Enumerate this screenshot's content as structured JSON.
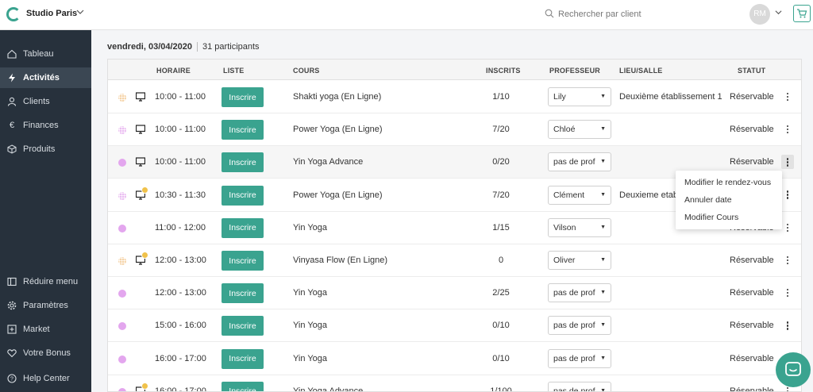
{
  "topbar": {
    "studio_name": "Studio Paris",
    "search_placeholder": "Rechercher par client",
    "avatar_initials": "RM"
  },
  "sidebar": {
    "items": [
      {
        "label": "Tableau",
        "icon": "home-icon"
      },
      {
        "label": "Activités",
        "icon": "lightning-icon",
        "active": true
      },
      {
        "label": "Clients",
        "icon": "user-icon"
      },
      {
        "label": "Finances",
        "icon": "euro-icon"
      },
      {
        "label": "Produits",
        "icon": "box-icon"
      }
    ],
    "bottom_items": [
      {
        "label": "Réduire menu",
        "icon": "sidebar-collapse-icon"
      },
      {
        "label": "Paramètres",
        "icon": "gear-icon"
      },
      {
        "label": "Market",
        "icon": "plus-square-icon"
      },
      {
        "label": "Votre Bonus",
        "icon": "heart-icon"
      },
      {
        "label": "Help Center",
        "icon": "help-icon"
      }
    ]
  },
  "main": {
    "date": "vendredi, 03/04/2020",
    "participants": "31 participants"
  },
  "table": {
    "headers": {
      "horaire": "HORAIRE",
      "liste": "LISTE",
      "cours": "COURS",
      "inscrits": "INSCRITS",
      "professeur": "PROFESSEUR",
      "lieu": "LIEU/SALLE",
      "statut": "STATUT"
    },
    "button_label": "Inscrire",
    "rows": [
      {
        "time": "10:00 - 11:00",
        "course": "Shakti yoga (En Ligne)",
        "inscrits": "1/10",
        "prof": "Lily",
        "lieu": "Deuxième établissement 1",
        "statut": "Réservable",
        "dot_color": "#f2c48a",
        "pattern": true,
        "online": true,
        "badge": false
      },
      {
        "time": "10:00 - 11:00",
        "course": "Power Yoga (En Ligne)",
        "inscrits": "7/20",
        "prof": "Chloé",
        "lieu": "",
        "statut": "Réservable",
        "dot_color": "#e3a6ee",
        "pattern": true,
        "online": true,
        "badge": false
      },
      {
        "time": "10:00 - 11:00",
        "course": "Yin Yoga Advance",
        "inscrits": "0/20",
        "prof": "pas de prof",
        "lieu": "",
        "statut": "Réservable",
        "dot_color": "#e3a6ee",
        "pattern": false,
        "online": true,
        "badge": false
      },
      {
        "time": "10:30 - 11:30",
        "course": "Power Yoga (En Ligne)",
        "inscrits": "7/20",
        "prof": "Clément",
        "lieu": "Deuxieme etab",
        "statut": "",
        "dot_color": "#e3a6ee",
        "pattern": true,
        "online": true,
        "badge": true
      },
      {
        "time": "11:00 - 12:00",
        "course": "Yin Yoga",
        "inscrits": "1/15",
        "prof": "Vilson",
        "lieu": "",
        "statut": "Réservable",
        "dot_color": "#e3a6ee",
        "pattern": false,
        "online": false,
        "badge": false
      },
      {
        "time": "12:00 - 13:00",
        "course": "Vinyasa Flow (En Ligne)",
        "inscrits": "0",
        "prof": "Oliver",
        "lieu": "",
        "statut": "Réservable",
        "dot_color": "#f2c48a",
        "pattern": true,
        "online": true,
        "badge": true
      },
      {
        "time": "12:00 - 13:00",
        "course": "Yin Yoga",
        "inscrits": "2/25",
        "prof": "pas de prof",
        "lieu": "",
        "statut": "Réservable",
        "dot_color": "#e3a6ee",
        "pattern": false,
        "online": false,
        "badge": false
      },
      {
        "time": "15:00 - 16:00",
        "course": "Yin Yoga",
        "inscrits": "0/10",
        "prof": "pas de prof",
        "lieu": "",
        "statut": "Réservable",
        "dot_color": "#e3a6ee",
        "pattern": false,
        "online": false,
        "badge": false
      },
      {
        "time": "16:00 - 17:00",
        "course": "Yin Yoga",
        "inscrits": "0/10",
        "prof": "pas de prof",
        "lieu": "",
        "statut": "Réservable",
        "dot_color": "#e3a6ee",
        "pattern": false,
        "online": false,
        "badge": false
      },
      {
        "time": "16:00 - 17:00",
        "course": "Yin Yoga Advance",
        "inscrits": "1/100",
        "prof": "pas de prof",
        "lieu": "",
        "statut": "Réservable",
        "dot_color": "#e3a6ee",
        "pattern": false,
        "online": true,
        "badge": true
      }
    ]
  },
  "context_menu": {
    "items": [
      "Modifier le rendez-vous",
      "Annuler date",
      "Modifier Cours"
    ]
  },
  "colors": {
    "accent": "#3aa38f",
    "sidebar": "#27313c"
  }
}
